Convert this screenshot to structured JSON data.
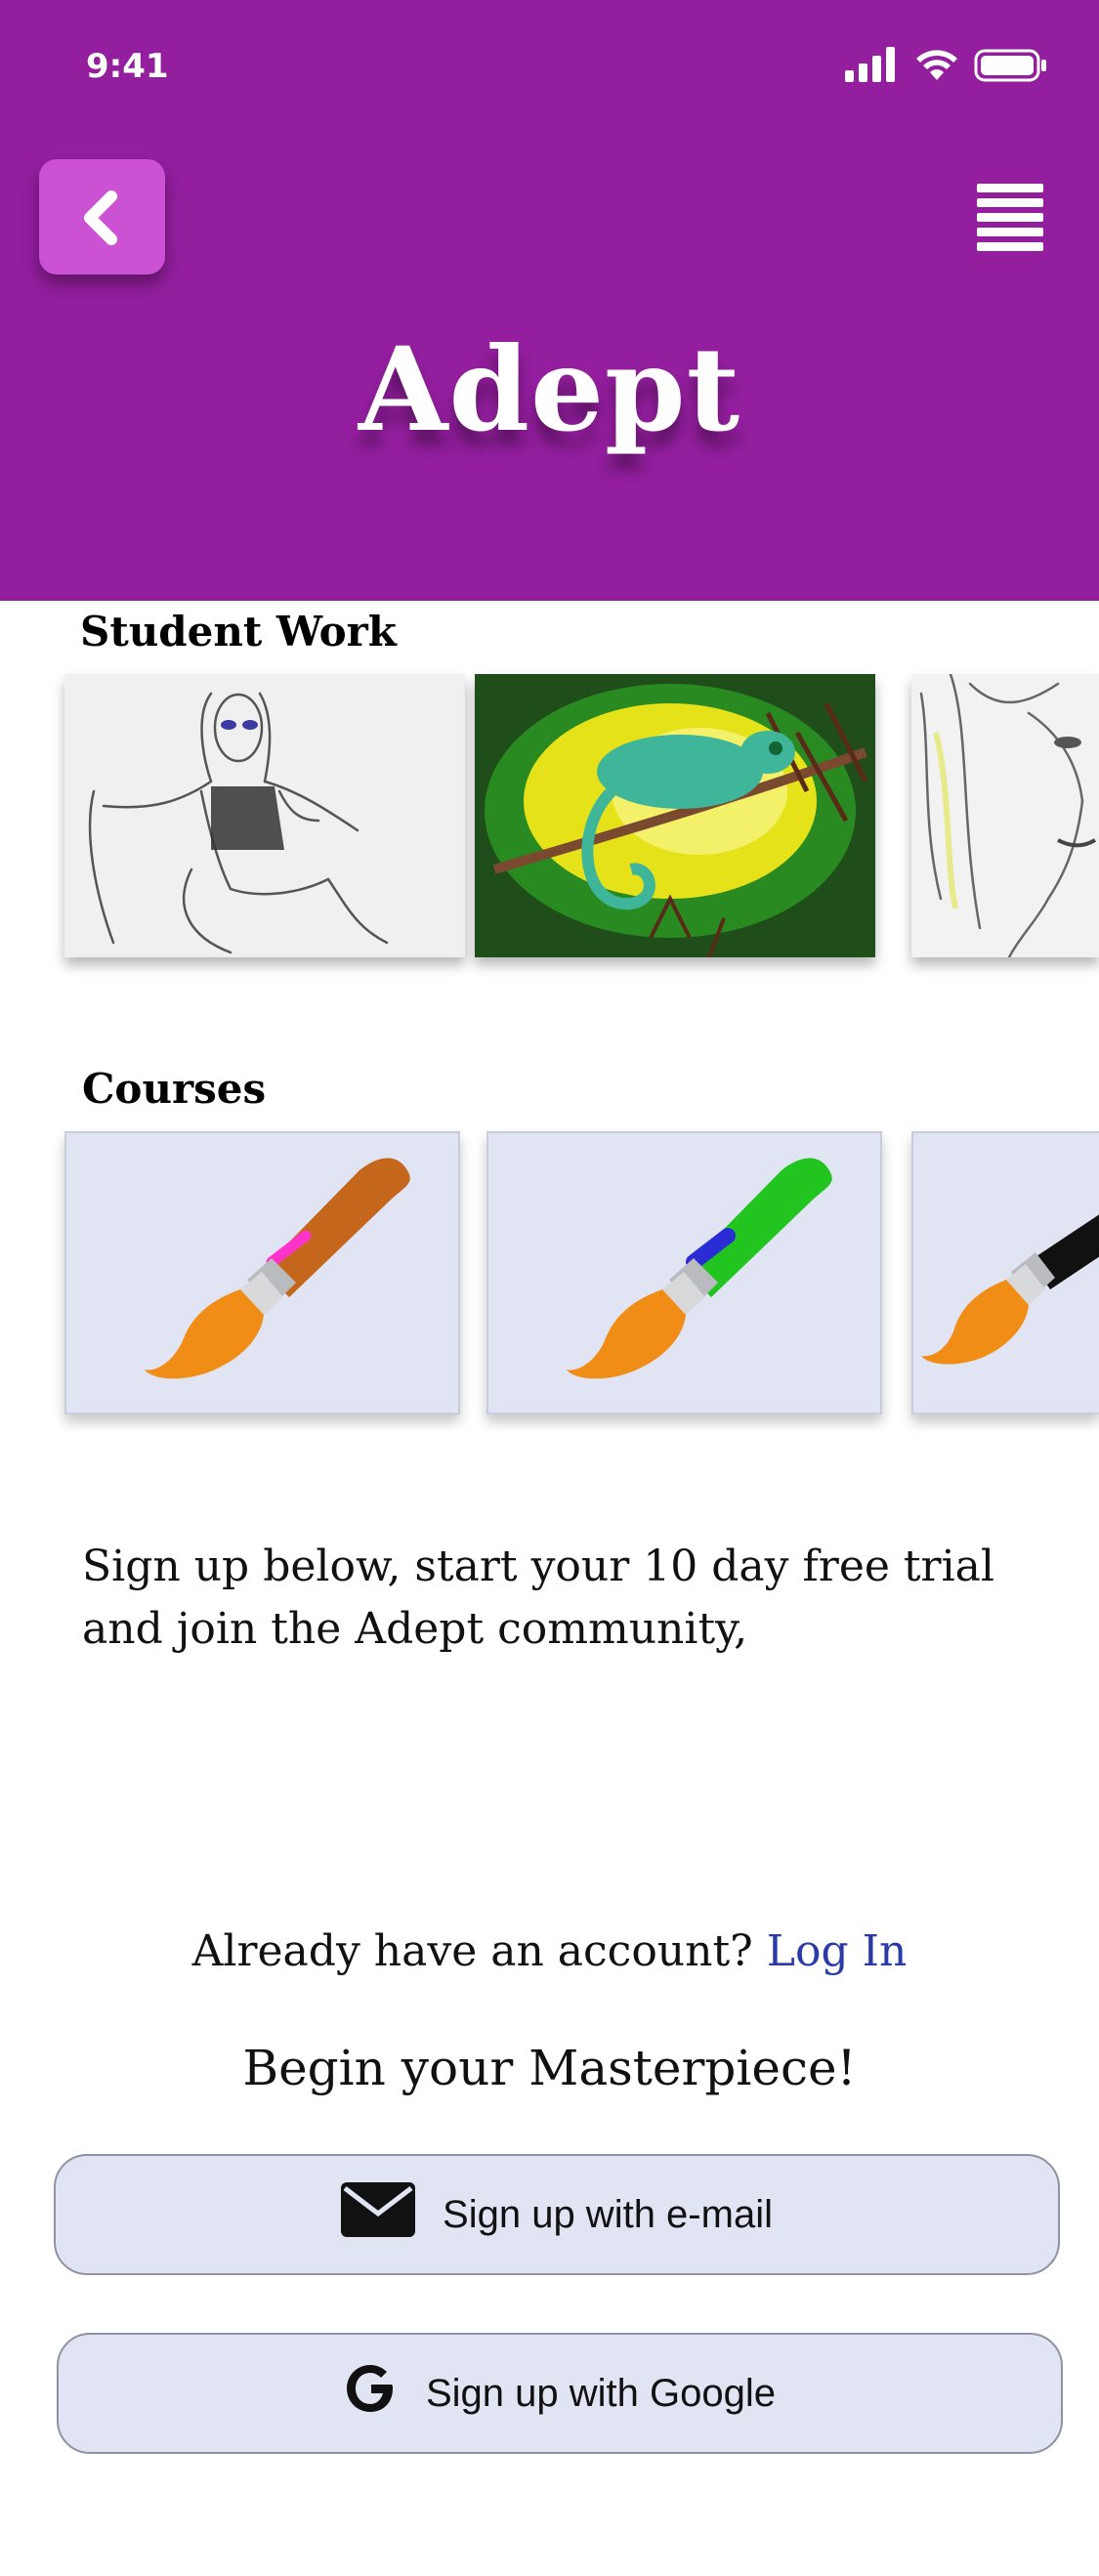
{
  "status_bar": {
    "time": "9:41",
    "icons": [
      "signal-icon",
      "wifi-icon",
      "battery-icon"
    ]
  },
  "header": {
    "title": "Adept",
    "back_icon": "chevron-left-icon",
    "menu_icon": "hamburger-menu-icon",
    "background": "#931e9e",
    "back_button_color": "#cc52d4"
  },
  "student_work": {
    "title": "Student Work",
    "items": [
      {
        "image": "pencil-sketch-seated-woman"
      },
      {
        "image": "chameleon-painting"
      },
      {
        "image": "pencil-sketch-woman-portrait"
      }
    ]
  },
  "courses": {
    "title": "Courses",
    "items": [
      {
        "icon": "paintbrush-icon",
        "handle_color": "#c4661c",
        "accent_color": "#ff33cc"
      },
      {
        "icon": "paintbrush-icon",
        "handle_color": "#22c51f",
        "accent_color": "#2a2cd6"
      },
      {
        "icon": "paintbrush-icon",
        "handle_color": "#111111",
        "accent_color": "#555555"
      }
    ]
  },
  "intro_text": "Sign up below, start your 10 day free trial and join the Adept community,",
  "account": {
    "prompt": "Already have an account?",
    "login_label": "Log In"
  },
  "tagline": "Begin your Masterpiece!",
  "buttons": {
    "email": {
      "label": "Sign up with e-mail",
      "icon": "envelope-icon"
    },
    "google": {
      "label": "Sign up with Google",
      "icon": "google-g-icon"
    }
  },
  "colors": {
    "card_background": "#e1e4f3",
    "link": "#2a3aa8"
  }
}
